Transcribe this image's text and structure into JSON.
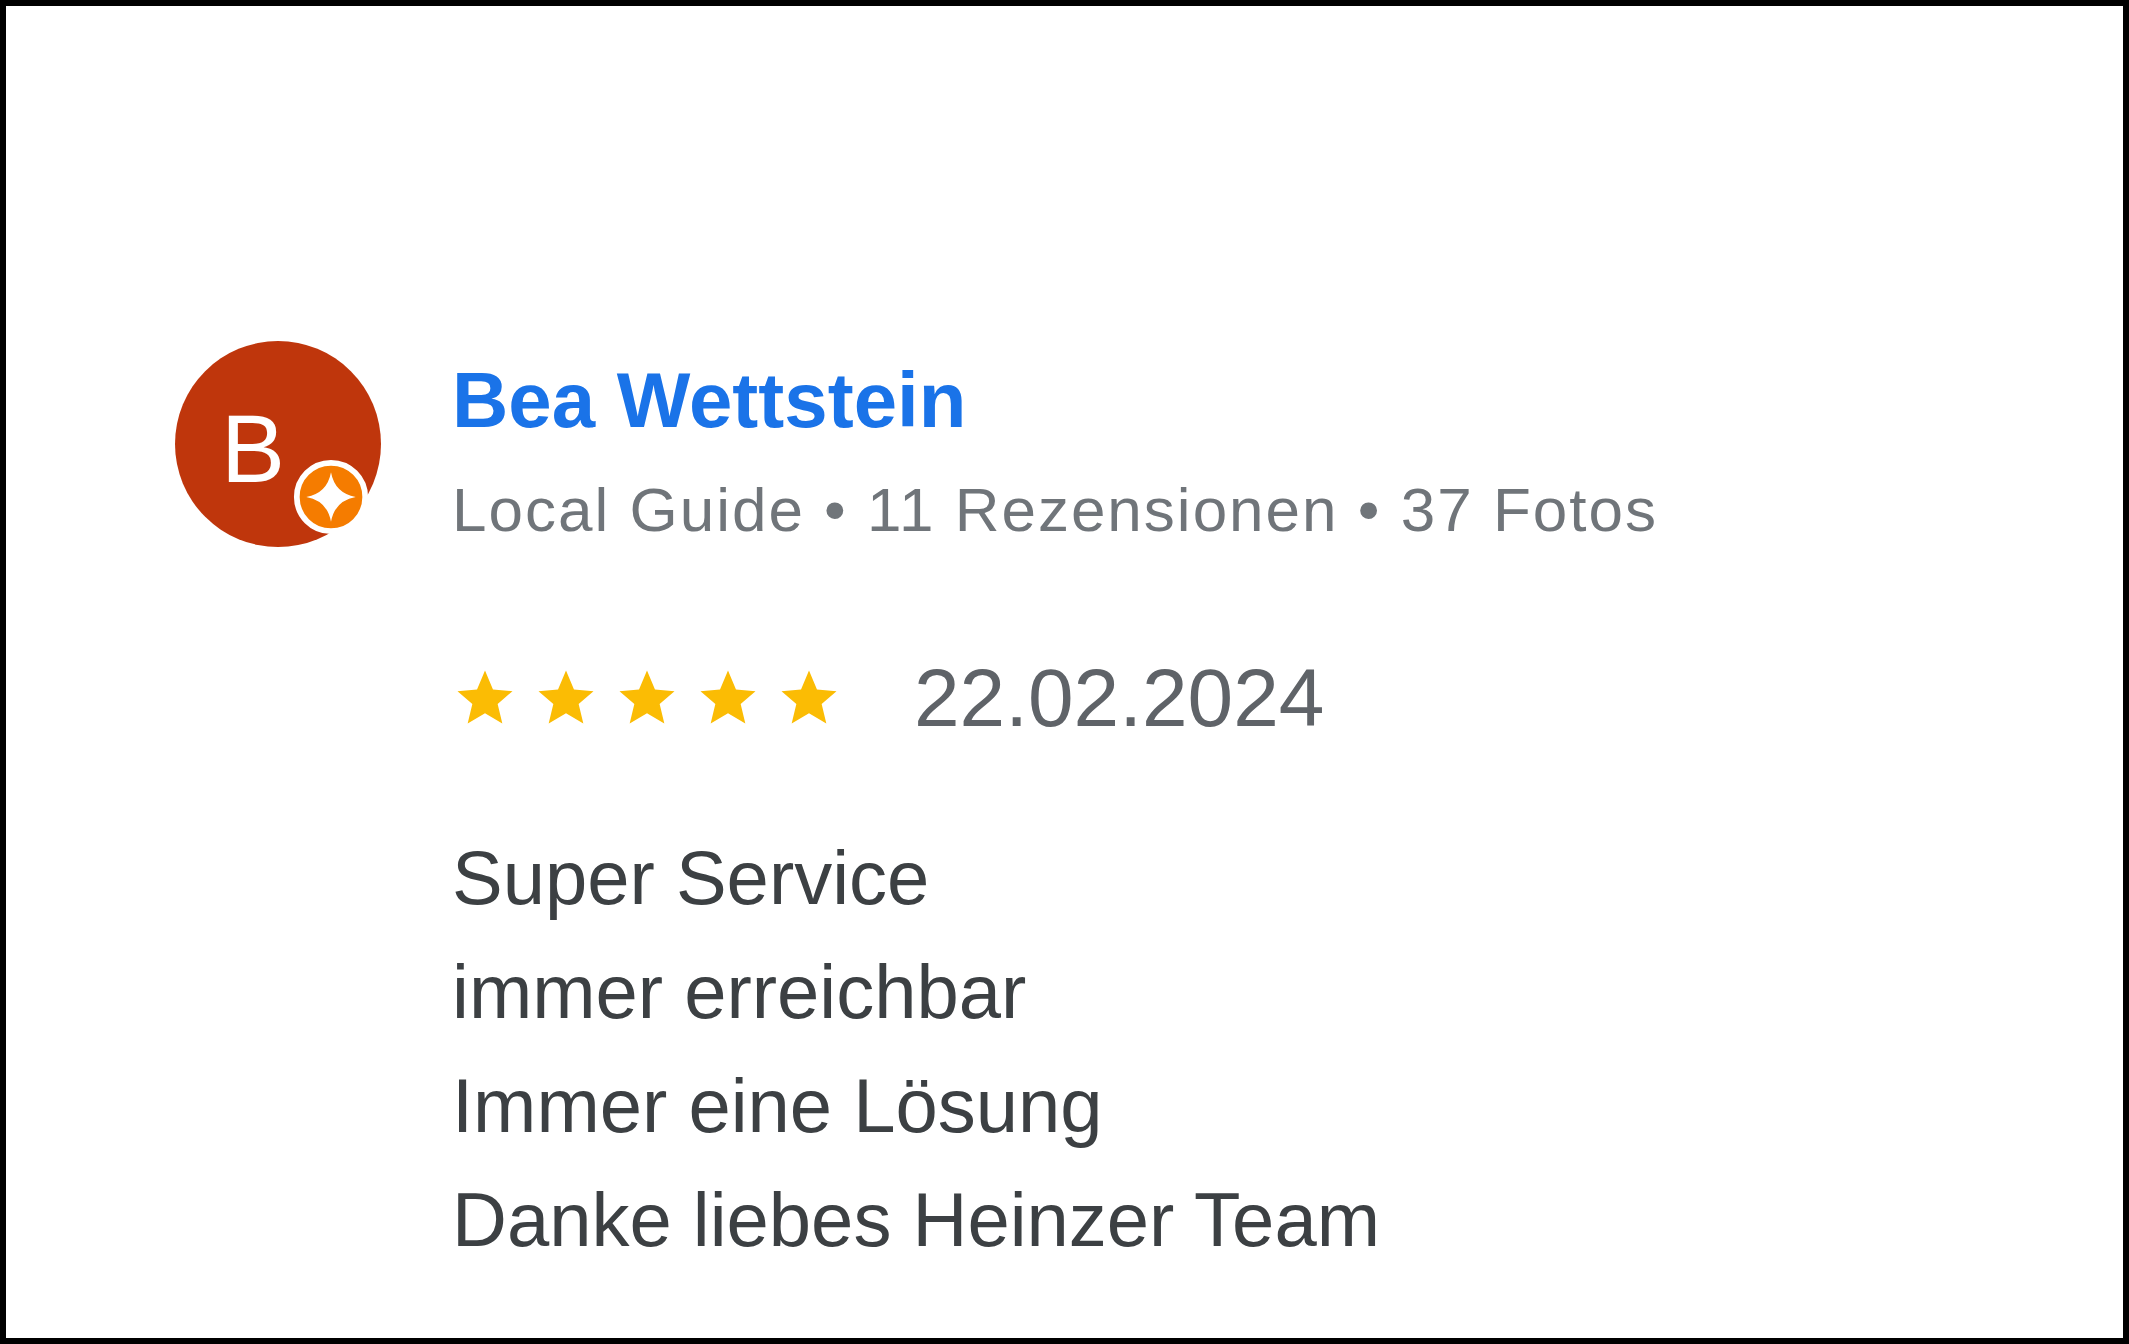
{
  "reviewer": {
    "avatar_letter": "B",
    "local_guide": true,
    "name": "Bea Wettstein",
    "meta": "Local Guide • 11 Rezensionen • 37 Fotos"
  },
  "review": {
    "stars": 5,
    "date": "22.02.2024",
    "lines": [
      "Super Service",
      "immer erreichbar",
      "Immer eine Lösung",
      "Danke liebes Heinzer Team"
    ]
  }
}
